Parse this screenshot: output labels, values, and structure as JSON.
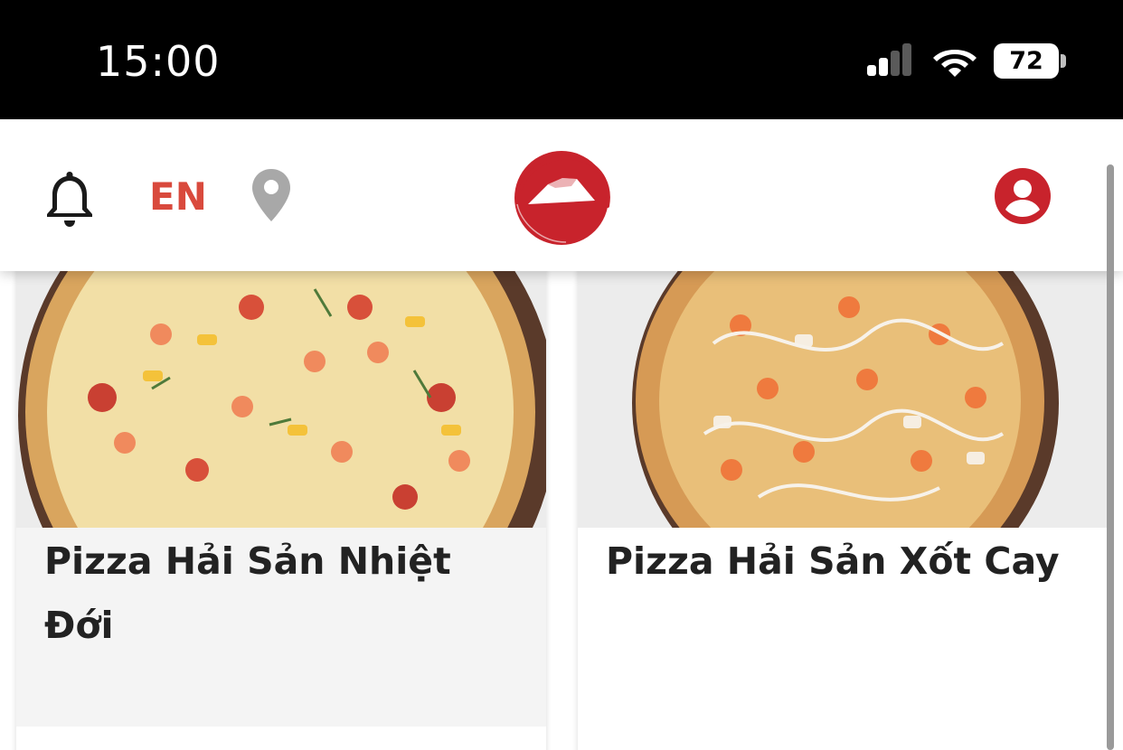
{
  "status_bar": {
    "time": "15:00",
    "battery_level": "72",
    "icons": [
      "signal-icon",
      "wifi-icon",
      "battery-icon"
    ]
  },
  "header": {
    "language_label": "EN",
    "icons": [
      "bell-icon",
      "location-pin-icon",
      "pizza-hut-logo",
      "account-icon"
    ],
    "colors": {
      "brand_red": "#c8232c",
      "language_red": "#d94a3d",
      "pin_gray": "#a8a8a8"
    }
  },
  "products": [
    {
      "name": "Pizza Hải Sản Nhiệt Đới"
    },
    {
      "name": "Pizza Hải Sản Xốt Cay"
    }
  ]
}
